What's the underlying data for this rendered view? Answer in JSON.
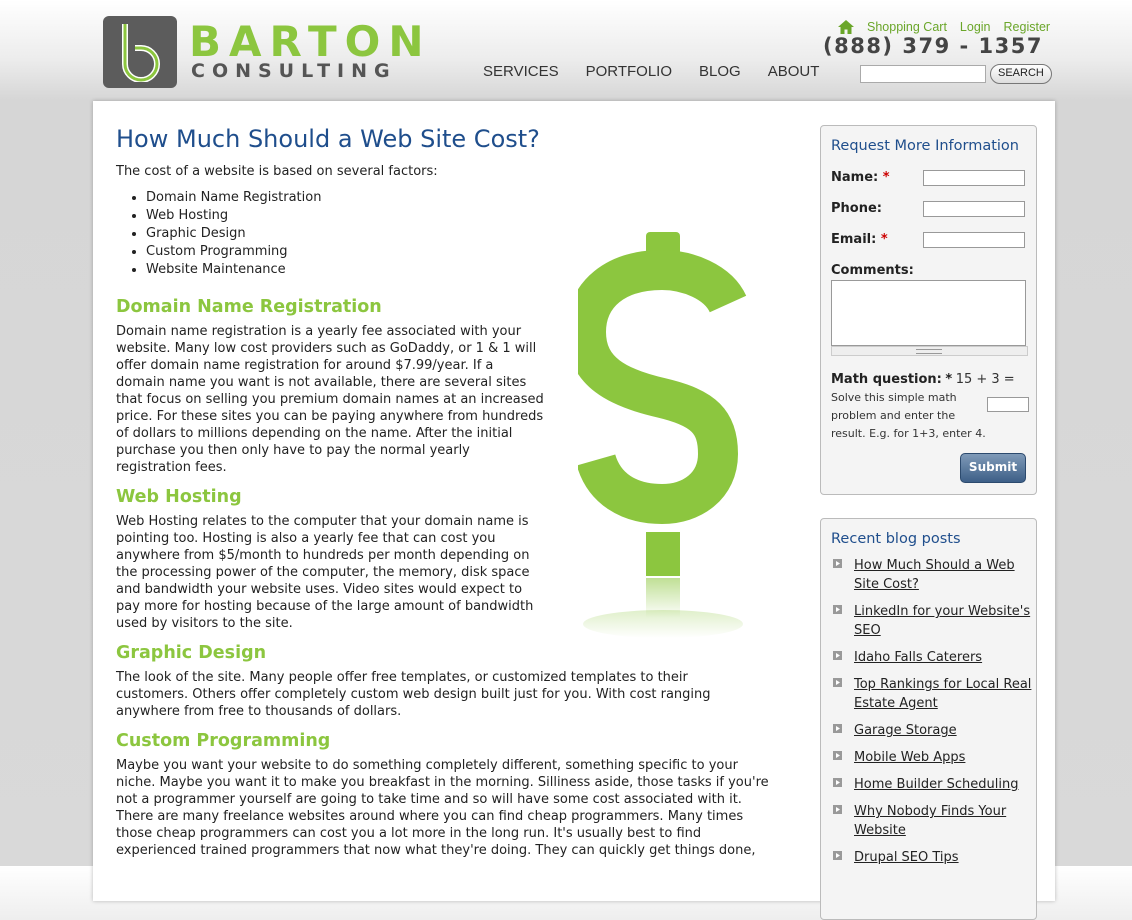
{
  "header": {
    "logo_line1": "BARTON",
    "logo_line2": "CONSULTING",
    "nav": [
      "SERVICES",
      "PORTFOLIO",
      "BLOG",
      "ABOUT"
    ],
    "top_links": [
      "Shopping Cart",
      "Login",
      "Register"
    ],
    "phone": "(888) 379 - 1357",
    "search_button": "SEARCH",
    "search_placeholder": "",
    "accent_color": "#8cc63f"
  },
  "main": {
    "title": "How Much Should a Web Site Cost?",
    "intro": "The cost of a website is based on several factors:",
    "factors": [
      "Domain Name Registration",
      "Web Hosting",
      "Graphic Design",
      "Custom Programming",
      "Website Maintenance"
    ],
    "sections": [
      {
        "heading": "Domain Name Registration",
        "text": "Domain name registration is a yearly fee associated with your website. Many low cost providers such as GoDaddy, or 1 & 1 will offer domain name registration for around $7.99/year. If a domain name you want is not available, there are several sites that focus on selling you premium domain names at an increased price. For these sites you can be paying anywhere from hundreds of dollars to millions depending on the name. After the initial purchase you then only have to pay the normal yearly registration fees."
      },
      {
        "heading": "Web Hosting",
        "text": "Web Hosting relates to the computer that your domain name is pointing too. Hosting is also a yearly fee that can cost you anywhere from $5/month to hundreds per month depending on the processing power of the computer, the memory, disk space and bandwidth your website uses. Video sites would expect to pay more for hosting because of the large amount of bandwidth used by visitors to the site."
      },
      {
        "heading": "Graphic Design",
        "text": "The look of the site. Many people offer free templates, or customized templates to their customers. Others offer completely custom web design built just for you. With cost ranging anywhere from free to thousands of dollars."
      },
      {
        "heading": "Custom Programming",
        "text": "Maybe you want your website to do something completely different, something specific to your niche. Maybe you want it to make you breakfast in the morning. Silliness aside, those tasks if you're not a programmer yourself are going to take time and so will have some cost associated with it. There are many freelance websites around where you can find cheap programmers. Many times those cheap programmers can cost you a lot more in the long run. It's usually best to find experienced trained programmers that now what they're doing. They can quickly get things done,"
      }
    ]
  },
  "sidebar": {
    "form": {
      "title": "Request More Information",
      "name_label": "Name:",
      "phone_label": "Phone:",
      "email_label": "Email:",
      "comments_label": "Comments:",
      "required_mark": "*",
      "math_label": "Math question:",
      "math_question": "15 + 3 =",
      "math_help": "Solve this simple math problem and enter the result. E.g. for 1+3, enter 4.",
      "submit_label": "Submit"
    },
    "blog": {
      "title": "Recent blog posts",
      "posts": [
        "How Much Should a Web Site Cost?",
        "LinkedIn for your Website's SEO",
        "Idaho Falls Caterers",
        "Top Rankings for Local Real Estate Agent",
        "Garage Storage",
        "Mobile Web Apps",
        "Home Builder Scheduling",
        "Why Nobody Finds Your Website",
        "Drupal SEO Tips"
      ]
    }
  }
}
